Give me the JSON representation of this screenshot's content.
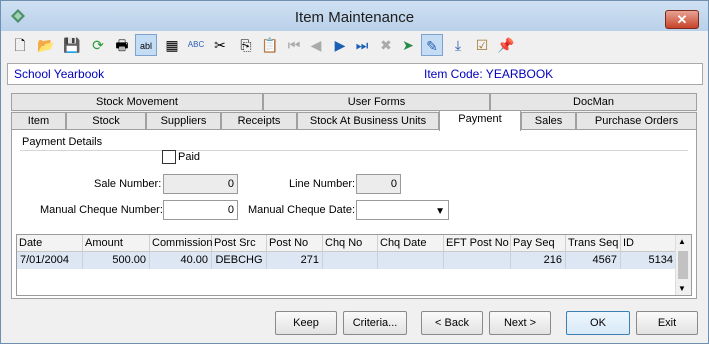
{
  "window": {
    "title": "Item Maintenance",
    "close_glyph": "✕"
  },
  "toolbar": {
    "icons": [
      "new-icon",
      "open-icon",
      "save-icon",
      "refresh-icon",
      "print-icon",
      "text-field-icon",
      "calculator-icon",
      "spellcheck-icon",
      "cut-icon",
      "copy-icon",
      "paste-icon",
      "first-record-icon",
      "previous-record-icon",
      "next-record-icon",
      "last-record-icon",
      "delete-icon",
      "goto-icon",
      "edit-record-icon",
      "download-icon",
      "clipboard-checklist-icon",
      "pin-icon"
    ]
  },
  "info": {
    "item_name": "School Yearbook",
    "item_code": "Item Code: YEARBOOK"
  },
  "tabs": {
    "row1": [
      "Stock Movement",
      "User Forms",
      "DocMan"
    ],
    "row2": [
      "Item",
      "Stock",
      "Suppliers",
      "Receipts",
      "Stock At Business Units",
      "Payment",
      "Sales",
      "Purchase Orders"
    ]
  },
  "payment": {
    "section": "Payment Details",
    "paid_label": "Paid",
    "sale_number_label": "Sale Number:",
    "sale_number": "0",
    "line_number_label": "Line Number:",
    "line_number": "0",
    "manual_cheque_number_label": "Manual Cheque Number:",
    "manual_cheque_number": "0",
    "manual_cheque_date_label": "Manual Cheque Date:",
    "manual_cheque_date": ""
  },
  "grid": {
    "columns": [
      "Date",
      "Amount",
      "Commission",
      "Post Src",
      "Post No",
      "Chq No",
      "Chq Date",
      "EFT Post No",
      "Pay Seq",
      "Trans Seq",
      "ID"
    ],
    "rows": [
      [
        "7/01/2004",
        "500.00",
        "40.00",
        "DEBCHG",
        "271",
        "",
        "",
        "",
        "216",
        "4567",
        "5134"
      ]
    ]
  },
  "buttons": {
    "keep": "Keep",
    "criteria": "Criteria...",
    "back": "< Back",
    "next": "Next >",
    "ok": "OK",
    "exit": "Exit"
  }
}
